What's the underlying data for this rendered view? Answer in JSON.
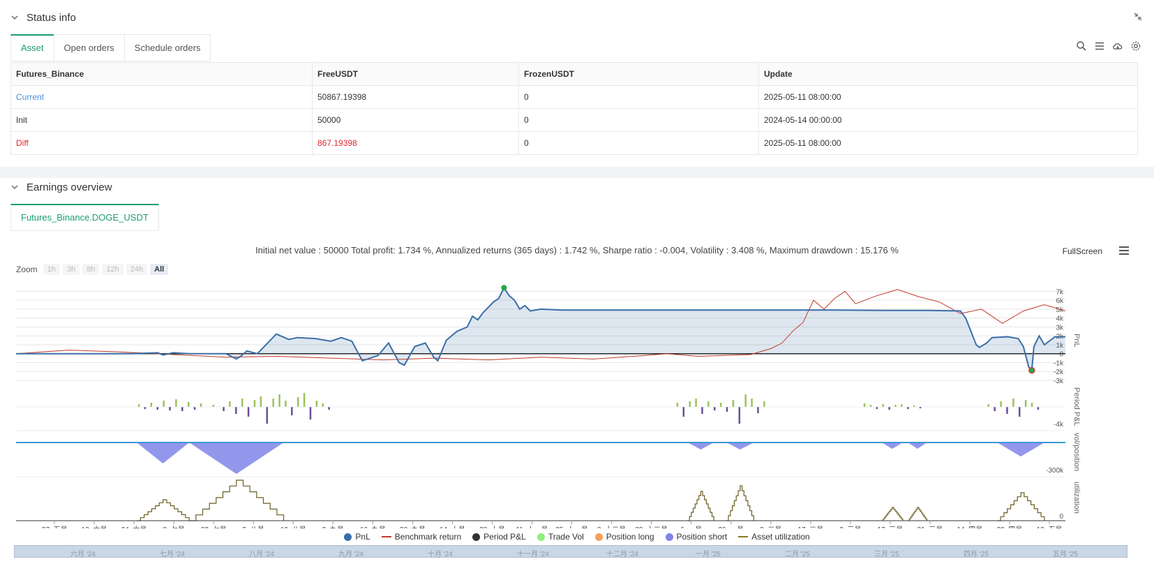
{
  "status_panel": {
    "title": "Status info",
    "tabs": [
      {
        "label": "Asset",
        "active": true
      },
      {
        "label": "Open orders",
        "active": false
      },
      {
        "label": "Schedule orders",
        "active": false
      }
    ],
    "table": {
      "headers": [
        "Futures_Binance",
        "FreeUSDT",
        "FrozenUSDT",
        "Update"
      ],
      "rows": [
        {
          "label": "Current",
          "free": "50867.19398",
          "frozen": "0",
          "update": "2025-05-11 08:00:00"
        },
        {
          "label": "Init",
          "free": "50000",
          "frozen": "0",
          "update": "2024-05-14 00:00:00"
        },
        {
          "label": "Diff",
          "free": "867.19398",
          "frozen": "0",
          "update": "2025-05-11 08:00:00"
        }
      ]
    }
  },
  "earnings_panel": {
    "title": "Earnings overview",
    "tab": "Futures_Binance.DOGE_USDT",
    "summary": "Initial net value : 50000 Total profit: 1.734 %, Annualized returns (365 days) : 1.742 %, Sharpe ratio : -0.004, Volatility : 3.408 %, Maximum drawdown : 15.176 %",
    "fullscreen_label": "FullScreen",
    "zoom": {
      "label": "Zoom",
      "options": [
        {
          "label": "1h",
          "active": false
        },
        {
          "label": "3h",
          "active": false
        },
        {
          "label": "8h",
          "active": false
        },
        {
          "label": "12h",
          "active": false
        },
        {
          "label": "24h",
          "active": false
        },
        {
          "label": "All",
          "active": true
        }
      ]
    },
    "legend": [
      {
        "label": "PnL",
        "kind": "dot",
        "color": "#3a6ea8"
      },
      {
        "label": "Benchmark return",
        "kind": "line",
        "color": "#c0392b"
      },
      {
        "label": "Period P&L",
        "kind": "dot",
        "color": "#333333"
      },
      {
        "label": "Trade Vol",
        "kind": "dot",
        "color": "#90ee7e"
      },
      {
        "label": "Position long",
        "kind": "dot",
        "color": "#f5a05a"
      },
      {
        "label": "Position short",
        "kind": "dot",
        "color": "#8085e9"
      },
      {
        "label": "Asset utilization",
        "kind": "line",
        "color": "#8a7a2a"
      }
    ],
    "navigator_labels": [
      "六月 '24",
      "七月 '24",
      "八月 '24",
      "九月 '24",
      "十月 '24",
      "十一月 '24",
      "十二月 '24",
      "一月 '25",
      "二月 '25",
      "三月 '25",
      "四月 '25",
      "五月 '25"
    ]
  },
  "chart_data": {
    "type": "line",
    "x_ticks": [
      "27. 五月",
      "10. 六月",
      "24. 六月",
      "8. 七月",
      "22. 七月",
      "5. 八月",
      "19. 八月",
      "2. 九月",
      "16. 九月",
      "30. 九月",
      "14. 十月",
      "28. 十月",
      "11. 十一月",
      "25. 十一月",
      "9. 十二月",
      "23. 十二月",
      "6. 一月",
      "20. 一月",
      "3. 二月",
      "17. 二月",
      "3. 三月",
      "17. 三月",
      "31. 三月",
      "14. 四月",
      "28. 四月",
      "12. 五月"
    ],
    "pnl_axis": {
      "label": "PnL",
      "ticks": [
        "7k",
        "6k",
        "5k",
        "4k",
        "3k",
        "2k",
        "1k",
        "0",
        "-1k",
        "-2k",
        "-3k"
      ],
      "ylim": [
        -3000,
        7500
      ]
    },
    "period_pnl_axis": {
      "label": "Period P&L",
      "ticks": [
        "-4k"
      ]
    },
    "position_axis": {
      "label": "vol/position",
      "ticks": [
        "-300k"
      ]
    },
    "utilization_axis": {
      "label": "utilization",
      "ticks": [
        "0"
      ]
    },
    "series": [
      {
        "name": "PnL",
        "points": [
          [
            0,
            0
          ],
          [
            0.11,
            0
          ],
          [
            0.135,
            100
          ],
          [
            0.14,
            -150
          ],
          [
            0.15,
            100
          ],
          [
            0.165,
            0
          ],
          [
            0.2,
            0
          ],
          [
            0.21,
            -600
          ],
          [
            0.215,
            -200
          ],
          [
            0.22,
            300
          ],
          [
            0.23,
            0
          ],
          [
            0.248,
            2200
          ],
          [
            0.26,
            1600
          ],
          [
            0.268,
            1800
          ],
          [
            0.285,
            1700
          ],
          [
            0.3,
            1400
          ],
          [
            0.31,
            1800
          ],
          [
            0.32,
            1400
          ],
          [
            0.33,
            -800
          ],
          [
            0.345,
            -200
          ],
          [
            0.355,
            1200
          ],
          [
            0.365,
            -1000
          ],
          [
            0.37,
            -1300
          ],
          [
            0.38,
            800
          ],
          [
            0.39,
            1200
          ],
          [
            0.398,
            -400
          ],
          [
            0.402,
            -800
          ],
          [
            0.41,
            1500
          ],
          [
            0.42,
            2500
          ],
          [
            0.43,
            3000
          ],
          [
            0.435,
            4200
          ],
          [
            0.44,
            3800
          ],
          [
            0.445,
            4600
          ],
          [
            0.45,
            5200
          ],
          [
            0.455,
            5800
          ],
          [
            0.46,
            6200
          ],
          [
            0.465,
            7400
          ],
          [
            0.47,
            6500
          ],
          [
            0.475,
            6000
          ],
          [
            0.48,
            5000
          ],
          [
            0.485,
            5400
          ],
          [
            0.49,
            4800
          ],
          [
            0.5,
            5000
          ],
          [
            0.52,
            4900
          ],
          [
            0.6,
            4900
          ],
          [
            0.7,
            4900
          ],
          [
            0.78,
            4900
          ],
          [
            0.84,
            4850
          ],
          [
            0.87,
            4850
          ],
          [
            0.9,
            4800
          ],
          [
            0.905,
            4000
          ],
          [
            0.91,
            2500
          ],
          [
            0.915,
            1000
          ],
          [
            0.918,
            700
          ],
          [
            0.925,
            1200
          ],
          [
            0.93,
            1800
          ],
          [
            0.945,
            1900
          ],
          [
            0.955,
            1700
          ],
          [
            0.96,
            800
          ],
          [
            0.965,
            -1500
          ],
          [
            0.968,
            -1800
          ],
          [
            0.97,
            800
          ],
          [
            0.975,
            2000
          ],
          [
            0.98,
            1000
          ],
          [
            0.99,
            1900
          ],
          [
            1.0,
            1900
          ]
        ]
      },
      {
        "name": "Benchmark return",
        "points": [
          [
            0,
            0
          ],
          [
            0.05,
            400
          ],
          [
            0.1,
            200
          ],
          [
            0.15,
            -100
          ],
          [
            0.2,
            -400
          ],
          [
            0.25,
            -300
          ],
          [
            0.3,
            -500
          ],
          [
            0.35,
            -700
          ],
          [
            0.4,
            -500
          ],
          [
            0.45,
            -700
          ],
          [
            0.5,
            -400
          ],
          [
            0.55,
            -600
          ],
          [
            0.6,
            -200
          ],
          [
            0.62,
            0
          ],
          [
            0.65,
            -300
          ],
          [
            0.7,
            -100
          ],
          [
            0.72,
            600
          ],
          [
            0.73,
            1200
          ],
          [
            0.74,
            2500
          ],
          [
            0.75,
            3500
          ],
          [
            0.76,
            6000
          ],
          [
            0.77,
            5000
          ],
          [
            0.78,
            6200
          ],
          [
            0.79,
            7000
          ],
          [
            0.8,
            5600
          ],
          [
            0.82,
            6500
          ],
          [
            0.84,
            7200
          ],
          [
            0.86,
            6400
          ],
          [
            0.88,
            5800
          ],
          [
            0.9,
            4500
          ],
          [
            0.92,
            5000
          ],
          [
            0.94,
            3400
          ],
          [
            0.96,
            4800
          ],
          [
            0.98,
            5500
          ],
          [
            1.0,
            4800
          ]
        ]
      }
    ]
  }
}
